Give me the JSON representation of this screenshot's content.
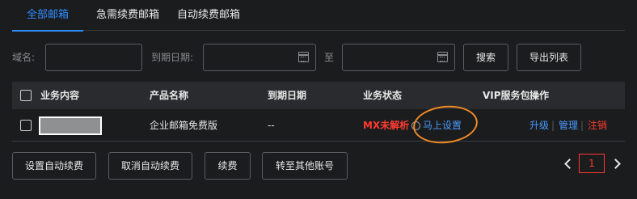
{
  "tabs": [
    {
      "label": "全部邮箱"
    },
    {
      "label": "急需续费邮箱"
    },
    {
      "label": "自动续费邮箱"
    }
  ],
  "filter": {
    "domain_label": "域名:",
    "domain_value": "",
    "expiry_label": "到期日期:",
    "range_sep": "至",
    "date_from": "",
    "date_to": "",
    "search_button": "搜索",
    "export_button": "导出列表"
  },
  "table": {
    "headers": {
      "content": "业务内容",
      "product": "产品名称",
      "expiry": "到期日期",
      "status": "业务状态",
      "vip": "VIP服务包",
      "actions": "操作"
    },
    "rows": [
      {
        "product": "企业邮箱免费版",
        "expiry": "--",
        "status": "MX未解析",
        "setup_link": "马上设置",
        "action_upgrade": "升级",
        "action_manage": "管理",
        "action_logout": "注销",
        "separator": "|"
      }
    ]
  },
  "footer": {
    "buttons": [
      "设置自动续费",
      "取消自动续费",
      "续费",
      "转至其他账号"
    ],
    "current_page": "1"
  },
  "colors": {
    "accent": "#2f8cff",
    "danger": "#ff3b30",
    "annotation": "#f08a24"
  }
}
